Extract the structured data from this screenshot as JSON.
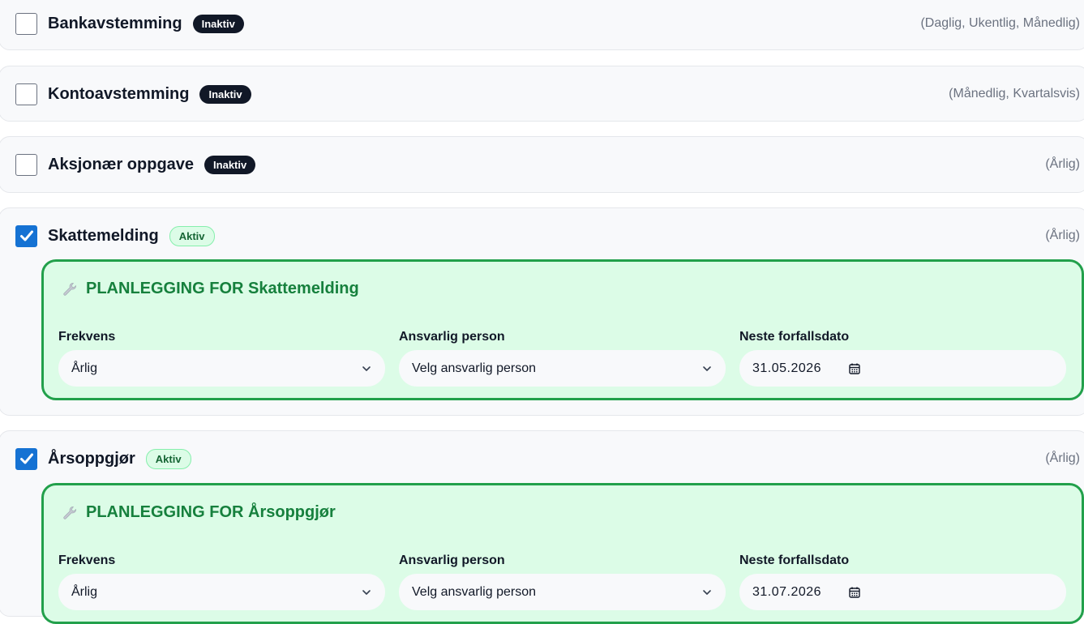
{
  "tasks": [
    {
      "name": "Bankavstemming",
      "status": "Inaktiv",
      "frequencies": "(Daglig, Ukentlig, Månedlig)",
      "checked": false
    },
    {
      "name": "Kontoavstemming",
      "status": "Inaktiv",
      "frequencies": "(Månedlig, Kvartalsvis)",
      "checked": false
    },
    {
      "name": "Aksjonær oppgave",
      "status": "Inaktiv",
      "frequencies": "(Årlig)",
      "checked": false
    },
    {
      "name": "Skattemelding",
      "status": "Aktiv",
      "frequencies": "(Årlig)",
      "checked": true,
      "plan": {
        "title": "PLANLEGGING FOR Skattemelding",
        "frequency_label": "Frekvens",
        "frequency_value": "Årlig",
        "responsible_label": "Ansvarlig person",
        "responsible_value": "Velg ansvarlig person",
        "due_label": "Neste forfallsdato",
        "due_value": "31.05.2026"
      }
    },
    {
      "name": "Årsoppgjør",
      "status": "Aktiv",
      "frequencies": "(Årlig)",
      "checked": true,
      "plan": {
        "title": "PLANLEGGING FOR Årsoppgjør",
        "frequency_label": "Frekvens",
        "frequency_value": "Årlig",
        "responsible_label": "Ansvarlig person",
        "responsible_value": "Velg ansvarlig person",
        "due_label": "Neste forfallsdato",
        "due_value": "31.07.2026"
      }
    }
  ],
  "icons": {
    "wrench": "wrench-icon",
    "chevron": "chevron-down-icon",
    "calendar": "calendar-icon",
    "check": "checkmark-icon"
  },
  "colors": {
    "checkbox_checked": "#1572d3",
    "inactive_badge": "#111827",
    "active_badge_bg": "#dcfce7",
    "active_badge_text": "#166534",
    "plan_border": "#22a04b",
    "plan_bg": "#dcfce7",
    "plan_title": "#16803d"
  }
}
